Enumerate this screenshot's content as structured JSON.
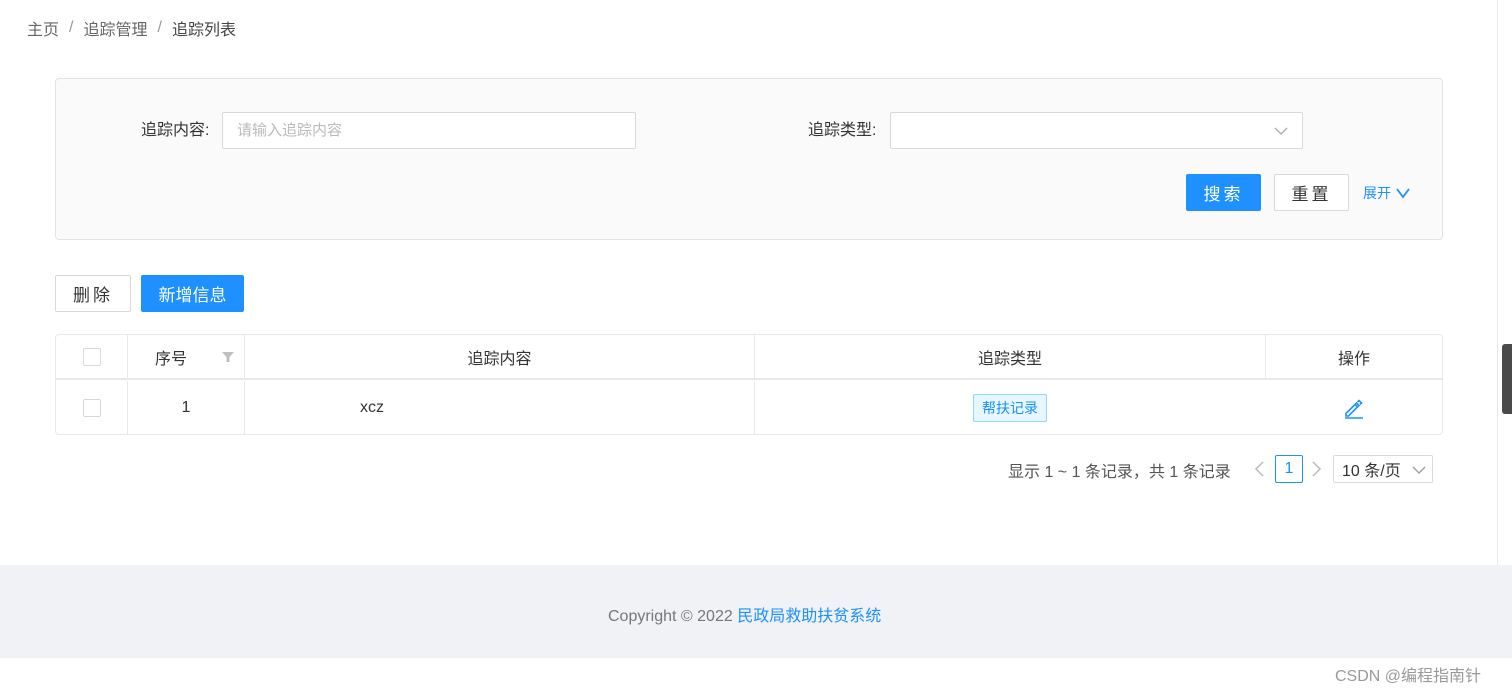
{
  "breadcrumb": {
    "home": "主页",
    "separator": "/",
    "section": "追踪管理",
    "current": "追踪列表"
  },
  "search": {
    "content_label": "追踪内容:",
    "content_placeholder": "请输入追踪内容",
    "content_value": "",
    "type_label": "追踪类型:",
    "type_value": "",
    "search_button": "搜索",
    "reset_button": "重置",
    "expand_link": "展开"
  },
  "actions": {
    "delete_button": "删除",
    "add_button": "新增信息"
  },
  "table": {
    "columns": [
      "序号",
      "追踪内容",
      "追踪类型",
      "操作"
    ],
    "rows": [
      {
        "index": "1",
        "content": "xcz",
        "type": "帮扶记录"
      }
    ]
  },
  "pagination": {
    "summary": "显示 1 ~ 1 条记录，共 1 条记录",
    "current_page": "1",
    "page_size": "10 条/页"
  },
  "footer": {
    "copyright": "Copyright © 2022",
    "brand": "民政局救助扶贫系统"
  },
  "watermark": "CSDN @编程指南针",
  "colors": {
    "accent": "#1e90ff",
    "tag_bg": "#e6f7ff",
    "footer_bg": "#f0f2f5"
  },
  "icons": {
    "select_chevron": "chevron-down-icon",
    "expand": "chevron-down-icon",
    "filter": "filter-icon",
    "edit": "edit-icon",
    "prev": "chevron-left-icon",
    "next": "chevron-right-icon"
  }
}
